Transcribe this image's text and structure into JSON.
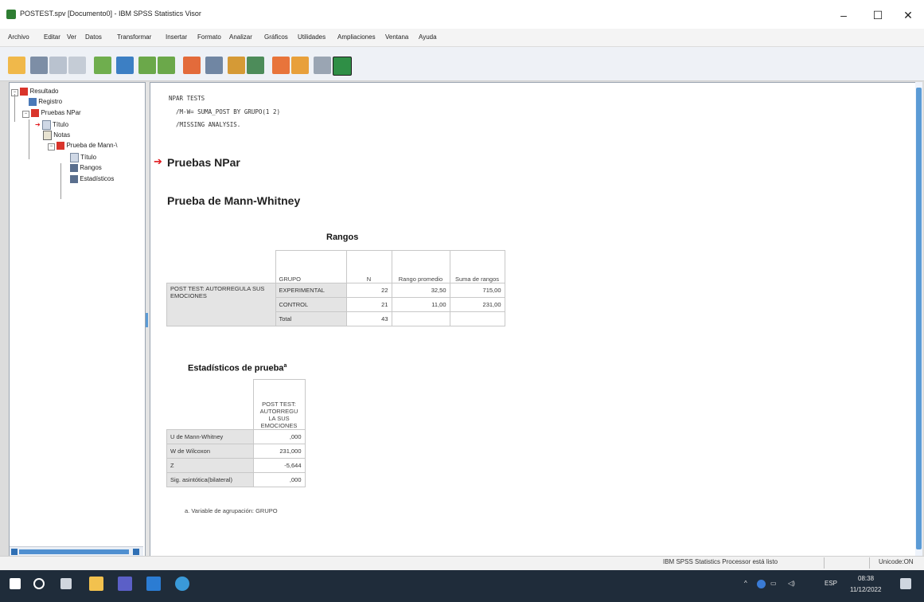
{
  "window": {
    "title": "POSTEST.spv [Documento0] - IBM SPSS Statistics Visor",
    "min_glyph": "–",
    "max_glyph": "☐",
    "close_glyph": "✕"
  },
  "menu": [
    "Archivo",
    "Editar",
    "Ver",
    "Datos",
    "Transformar",
    "Insertar",
    "Formato",
    "Analizar",
    "Gráficos",
    "Utilidades",
    "Ampliaciones",
    "Ventana",
    "Ayuda"
  ],
  "toolbar": {
    "icons": [
      "open-folder-icon",
      "save-icon",
      "print-icon",
      "print-preview-icon",
      "export-icon",
      "recall-dialog-icon",
      "undo-icon",
      "redo-icon",
      "goto-data-icon",
      "goto-case-icon",
      "variables-icon",
      "insert-table-icon",
      "promote-icon",
      "demote-icon",
      "show-all-icon",
      "designate-window-icon"
    ]
  },
  "outline": {
    "items": [
      "Resultado",
      "Registro",
      "Pruebas NPar",
      "Título",
      "Notas",
      "Prueba de Mann-\\",
      "Título",
      "Rangos",
      "Estadísticos"
    ]
  },
  "content": {
    "syntax": [
      "NPAR TESTS",
      "  /M-W= SUMA_POST BY GRUPO(1 2)",
      "  /MISSING ANALYSIS."
    ],
    "heading": "Pruebas NPar",
    "subheading": "Prueba de Mann-Whitney",
    "ranks": {
      "title": "Rangos",
      "headers": {
        "group": "GRUPO",
        "n": "N",
        "mean": "Rango promedio",
        "sum": "Suma de rangos"
      },
      "rowlabel": "POST TEST: AUTORREGULA SUS EMOCIONES",
      "rows": [
        {
          "group": "EXPERIMENTAL",
          "n": "22",
          "mean": "32,50",
          "sum": "715,00"
        },
        {
          "group": "CONTROL",
          "n": "21",
          "mean": "11,00",
          "sum": "231,00"
        },
        {
          "group": "Total",
          "n": "43",
          "mean": "",
          "sum": ""
        }
      ]
    },
    "stats": {
      "title": "Estadísticos de prueba",
      "sup": "a",
      "colhead": "POST TEST: AUTORREGU LA SUS EMOCIONES",
      "rows": [
        {
          "label": "U de Mann-Whitney",
          "value": ",000"
        },
        {
          "label": "W de Wilcoxon",
          "value": "231,000"
        },
        {
          "label": "Z",
          "value": "-5,644"
        },
        {
          "label": "Sig. asintótica(bilateral)",
          "value": ",000"
        }
      ],
      "footnote": "a. Variable de agrupación: GRUPO"
    }
  },
  "status": {
    "processor": "IBM SPSS Statistics Processor está listo",
    "unicode": "Unicode:ON"
  },
  "taskbar": {
    "icons": [
      "windows-start-icon",
      "search-icon",
      "task-view-icon",
      "file-explorer-icon",
      "chat-icon",
      "spss-icon",
      "browser-icon"
    ],
    "time": "08:38",
    "date": "11/12/2022",
    "lang": "ESP"
  }
}
